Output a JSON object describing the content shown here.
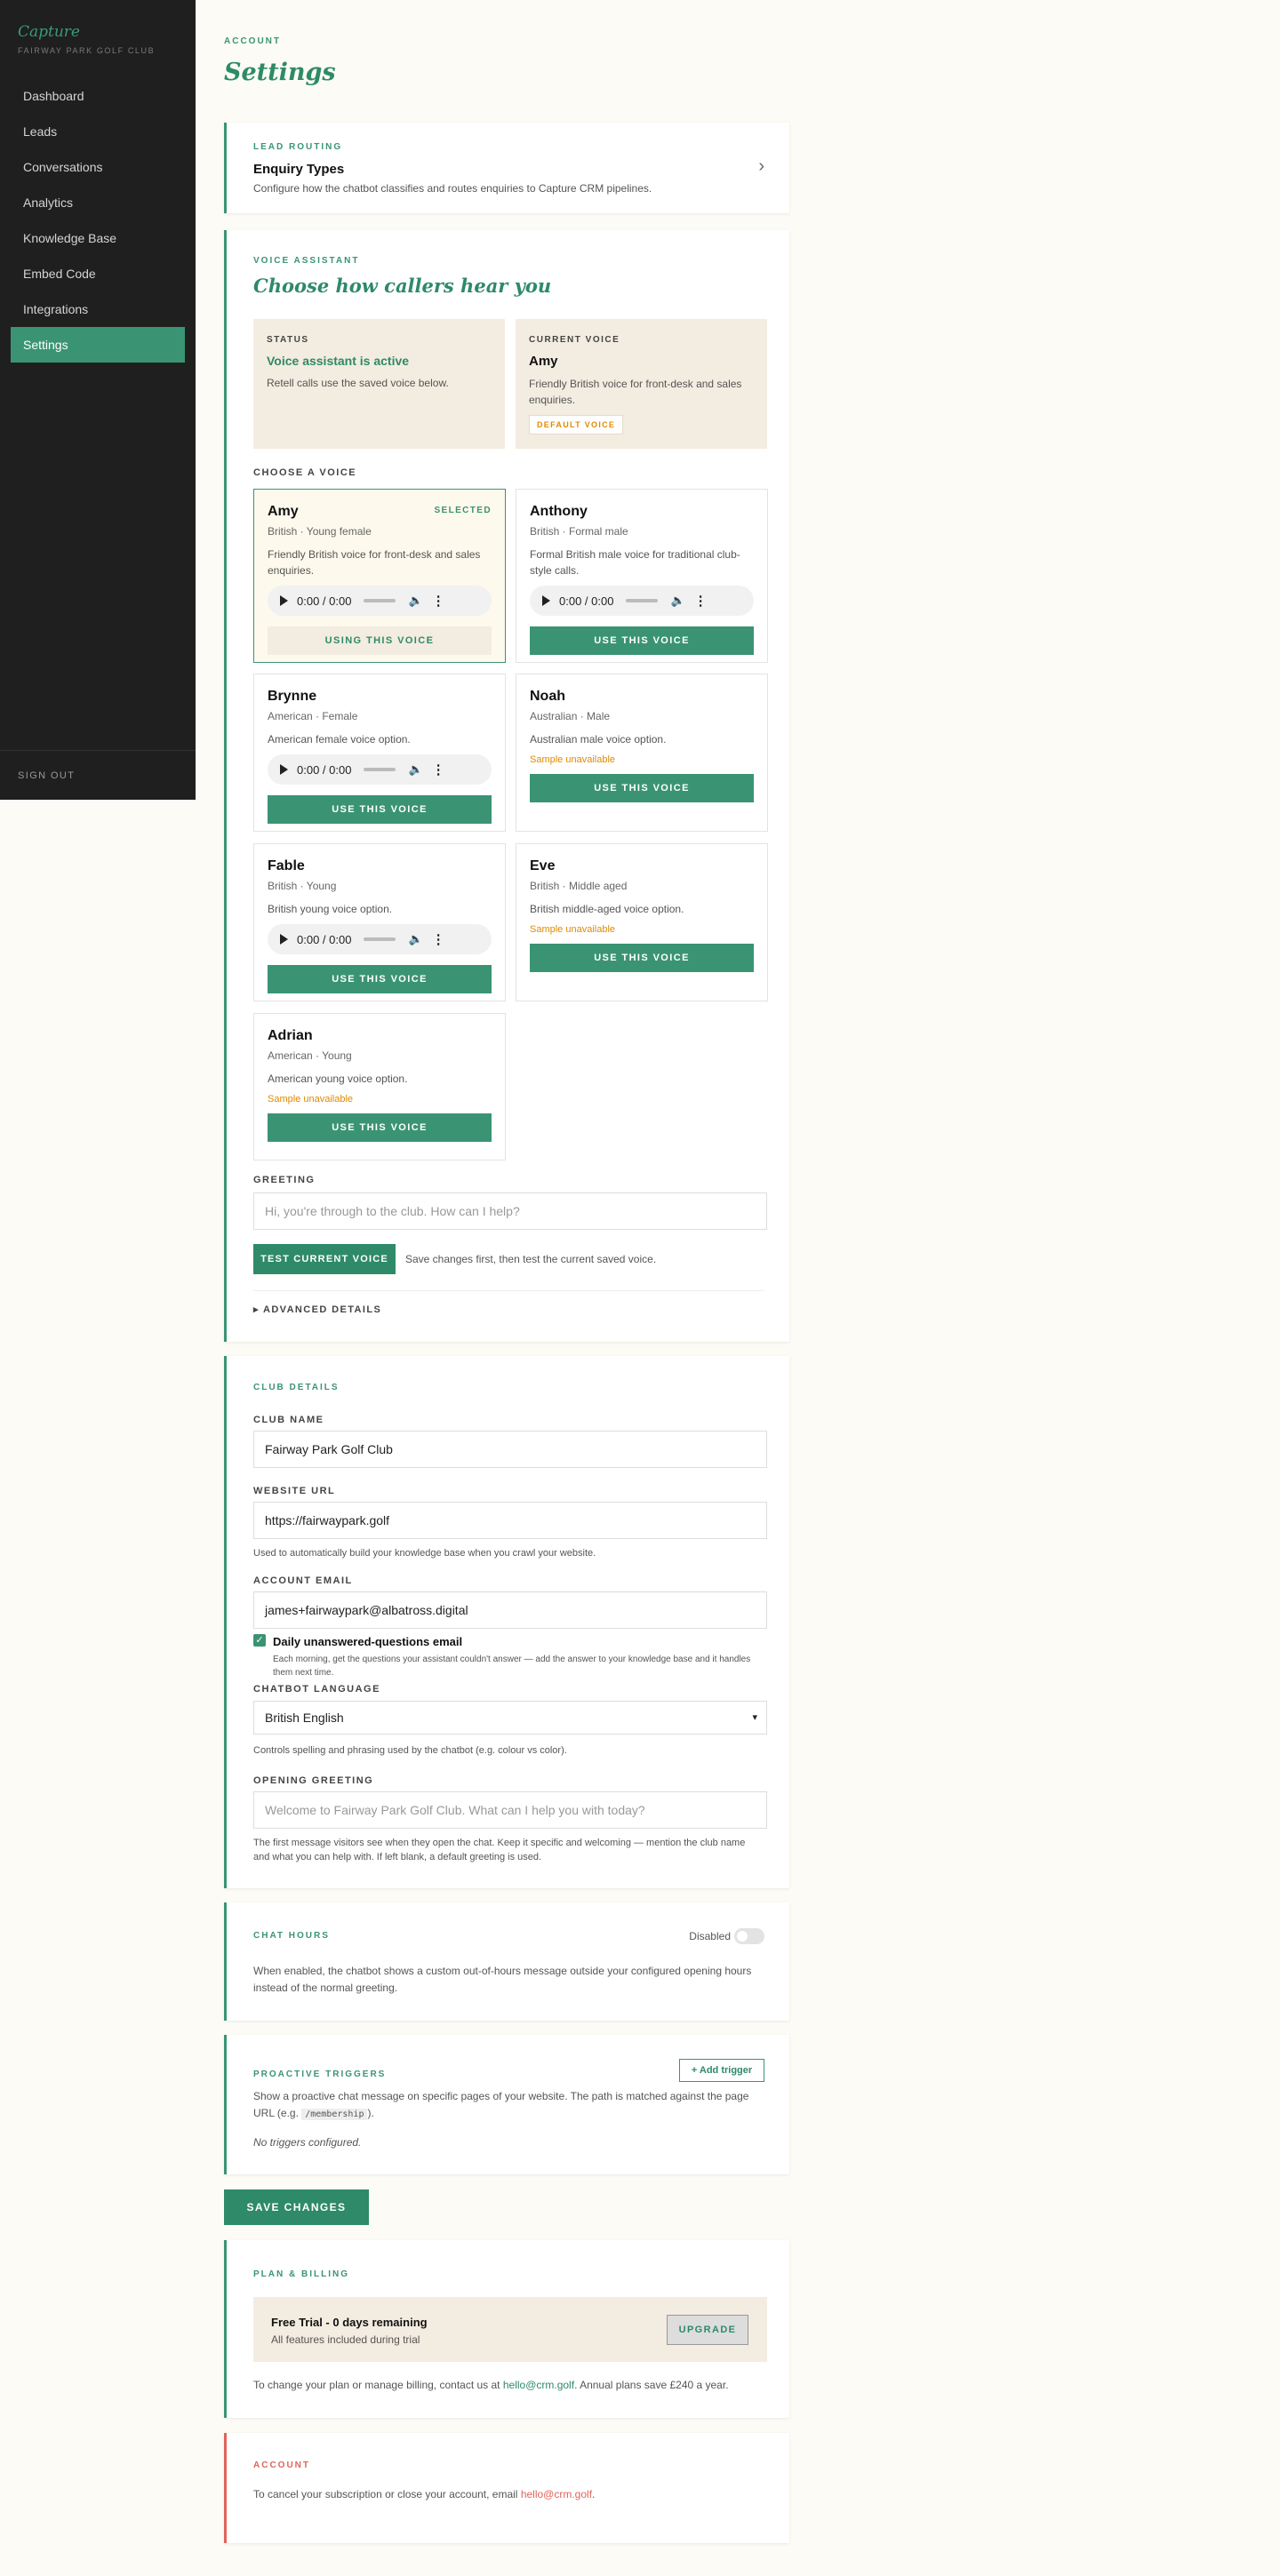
{
  "sidebar": {
    "logo": "Capture",
    "club": "FAIRWAY PARK GOLF CLUB",
    "items": [
      "Dashboard",
      "Leads",
      "Conversations",
      "Analytics",
      "Knowledge Base",
      "Embed Code",
      "Integrations",
      "Settings"
    ],
    "active": "Settings",
    "signout": "SIGN OUT"
  },
  "header": {
    "eyebrow": "ACCOUNT",
    "title": "Settings"
  },
  "lead_routing": {
    "eyebrow": "LEAD ROUTING",
    "title": "Enquiry Types",
    "desc": "Configure how the chatbot classifies and routes enquiries to Capture CRM pipelines.",
    "chevron": "›"
  },
  "voice": {
    "eyebrow": "VOICE ASSISTANT",
    "title": "Choose how callers hear you",
    "status_label": "STATUS",
    "status_title": "Voice assistant is active",
    "status_desc": "Retell calls use the saved voice below.",
    "current_label": "CURRENT VOICE",
    "current_name": "Amy",
    "current_desc": "Friendly British voice for front-desk and sales enquiries.",
    "default_badge": "DEFAULT VOICE",
    "choose_label": "CHOOSE A VOICE",
    "selected_badge": "SELECTED",
    "player_time": "0:00 / 0:00",
    "unavailable": "Sample unavailable",
    "voices": [
      {
        "name": "Amy",
        "meta": "British · Young female",
        "desc": "Friendly British voice for front-desk and sales enquiries.",
        "button": "USING THIS VOICE"
      },
      {
        "name": "Anthony",
        "meta": "British · Formal male",
        "desc": "Formal British male voice for traditional club-style calls.",
        "button": "USE THIS VOICE"
      },
      {
        "name": "Brynne",
        "meta": "American · Female",
        "desc": "American female voice option.",
        "button": "USE THIS VOICE"
      },
      {
        "name": "Noah",
        "meta": "Australian · Male",
        "desc": "Australian male voice option.",
        "button": "USE THIS VOICE"
      },
      {
        "name": "Fable",
        "meta": "British · Young",
        "desc": "British young voice option.",
        "button": "USE THIS VOICE"
      },
      {
        "name": "Eve",
        "meta": "British · Middle aged",
        "desc": "British middle-aged voice option.",
        "button": "USE THIS VOICE"
      },
      {
        "name": "Adrian",
        "meta": "American · Young",
        "desc": "American young voice option.",
        "button": "USE THIS VOICE"
      }
    ],
    "greeting_label": "GREETING",
    "greeting_placeholder": "Hi, you're through to the club. How can I help?",
    "test_button": "TEST CURRENT VOICE",
    "test_note": "Save changes first, then test the current saved voice.",
    "advanced": "▸ ADVANCED DETAILS"
  },
  "club": {
    "eyebrow": "CLUB DETAILS",
    "name_label": "CLUB NAME",
    "name_value": "Fairway Park Golf Club",
    "url_label": "WEBSITE URL",
    "url_value": "https://fairwaypark.golf",
    "url_help": "Used to automatically build your knowledge base when you crawl your website.",
    "email_label": "ACCOUNT EMAIL",
    "email_value": "james+fairwaypark@albatross.digital",
    "daily_label": "Daily unanswered-questions email",
    "daily_help": "Each morning, get the questions your assistant couldn't answer — add the answer to your knowledge base and it handles them next time.",
    "lang_label": "CHATBOT LANGUAGE",
    "lang_value": "British English",
    "lang_help": "Controls spelling and phrasing used by the chatbot (e.g. colour vs color).",
    "greet_label": "OPENING GREETING",
    "greet_placeholder": "Welcome to Fairway Park Golf Club. What can I help you with today?",
    "greet_help": "The first message visitors see when they open the chat. Keep it specific and welcoming — mention the club name and what you can help with. If left blank, a default greeting is used."
  },
  "hours": {
    "eyebrow": "CHAT HOURS",
    "toggle_label": "Disabled",
    "desc": "When enabled, the chatbot shows a custom out-of-hours message outside your configured opening hours instead of the normal greeting."
  },
  "triggers": {
    "eyebrow": "PROACTIVE TRIGGERS",
    "add_button": "+ Add trigger",
    "desc_before": "Show a proactive chat message on specific pages of your website. The path is matched against the page URL (e.g. ",
    "desc_code": "/membership",
    "desc_after": ").",
    "empty": "No triggers configured."
  },
  "save_button": "SAVE CHANGES",
  "billing": {
    "eyebrow": "PLAN & BILLING",
    "plan_title": "Free Trial - 0 days remaining",
    "plan_sub": "All features included during trial",
    "upgrade": "UPGRADE",
    "note_before": "To change your plan or manage billing, contact us at ",
    "note_link": "hello@crm.golf",
    "note_after": ". Annual plans save £240 a year."
  },
  "account": {
    "eyebrow": "ACCOUNT",
    "text_before": "To cancel your subscription or close your account, email ",
    "link": "hello@crm.golf",
    "text_after": "."
  },
  "colors": {
    "accent": "#3a9473",
    "danger": "#e0645a",
    "warning": "#e08a00",
    "sidebar": "#1f1f1f",
    "cream": "#f3ece0"
  }
}
